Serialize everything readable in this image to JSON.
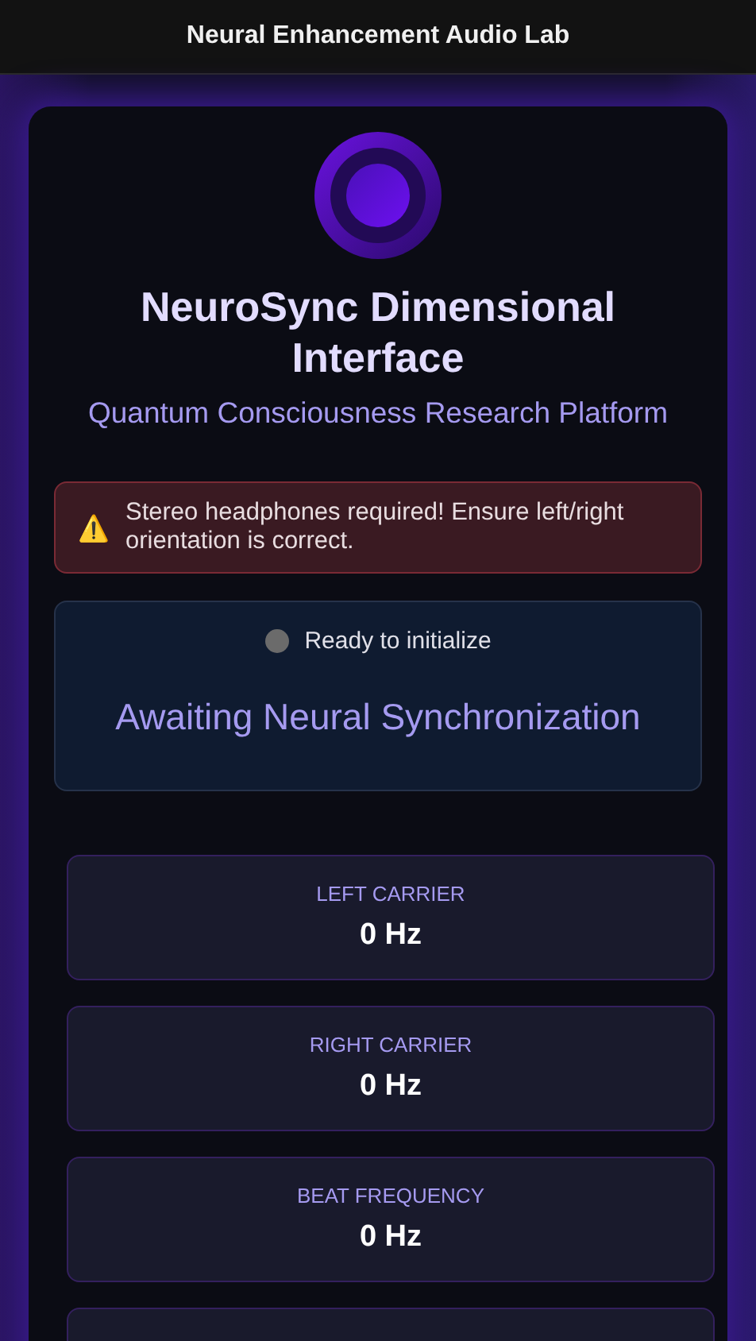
{
  "header": {
    "title": "Neural Enhancement Audio Lab"
  },
  "hero": {
    "title": "NeuroSync Dimensional Interface",
    "subtitle": "Quantum Consciousness Research Platform"
  },
  "alert": {
    "icon": "⚠️",
    "text": "Stereo headphones required! Ensure left/right orientation is correct."
  },
  "status": {
    "active": false,
    "text": "Ready to initialize",
    "message": "Awaiting Neural Synchronization"
  },
  "stats": [
    {
      "label": "LEFT CARRIER",
      "value": "0 Hz"
    },
    {
      "label": "RIGHT CARRIER",
      "value": "0 Hz"
    },
    {
      "label": "BEAT FREQUENCY",
      "value": "0 Hz"
    }
  ]
}
